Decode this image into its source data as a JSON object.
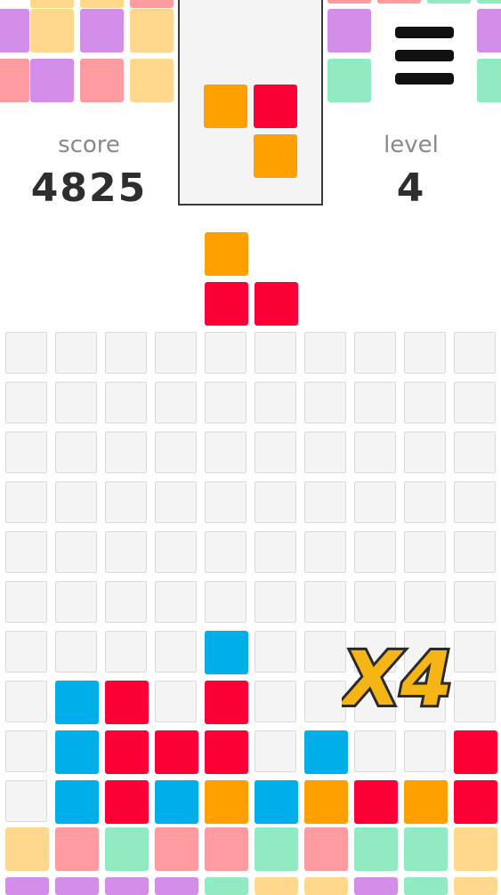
{
  "header": {
    "score_label": "score",
    "score_value": "4825",
    "level_label": "level",
    "level_value": "4"
  },
  "combo": {
    "text": "X4",
    "color": "#f5b514",
    "outline": "#2a2a2a"
  },
  "colors": {
    "orange": "#ffa000",
    "red": "#fb0034",
    "blue": "#00aeea",
    "cell": "#f4f4f4",
    "cell_border": "#d9d9d9",
    "pastel_pink": "#fd9ba0",
    "pastel_green": "#92eac3",
    "pastel_peach": "#ffd88d",
    "pastel_purple": "#d28ee9"
  },
  "next_piece": {
    "cells": [
      [
        0,
        0,
        "orange"
      ],
      [
        1,
        0,
        "red"
      ],
      [
        1,
        1,
        "orange"
      ]
    ]
  },
  "falling_piece": {
    "cells": [
      [
        4,
        0,
        "orange"
      ],
      [
        4,
        1,
        "red"
      ],
      [
        5,
        1,
        "red"
      ]
    ]
  },
  "board": {
    "cols": 10,
    "rows": 10,
    "filled": [
      [
        4,
        6,
        "blue"
      ],
      [
        1,
        7,
        "blue"
      ],
      [
        2,
        7,
        "red"
      ],
      [
        4,
        7,
        "red"
      ],
      [
        1,
        8,
        "blue"
      ],
      [
        2,
        8,
        "red"
      ],
      [
        3,
        8,
        "red"
      ],
      [
        4,
        8,
        "red"
      ],
      [
        6,
        8,
        "blue"
      ],
      [
        9,
        8,
        "red"
      ],
      [
        1,
        9,
        "blue"
      ],
      [
        2,
        9,
        "red"
      ],
      [
        3,
        9,
        "blue"
      ],
      [
        4,
        9,
        "orange"
      ],
      [
        5,
        9,
        "blue"
      ],
      [
        6,
        9,
        "orange"
      ],
      [
        7,
        9,
        "red"
      ],
      [
        8,
        9,
        "orange"
      ],
      [
        9,
        9,
        "red"
      ]
    ]
  },
  "decor": {
    "top_left": [
      [
        "pastel_peach",
        "pastel_peach",
        "pastel_pink"
      ],
      [
        "pastel_purple",
        "pastel_peach",
        "pastel_purple",
        "pastel_peach"
      ],
      [
        "pastel_pink",
        "pastel_purple",
        "pastel_pink",
        "pastel_peach"
      ]
    ],
    "top_right": [
      [
        "pastel_pink",
        "pastel_pink",
        "pastel_green",
        "pastel_green"
      ],
      [
        "pastel_purple",
        "pastel_purple"
      ],
      [
        "pastel_green",
        "pastel_green"
      ]
    ],
    "bottom_row": [
      "pastel_peach",
      "pastel_pink",
      "pastel_green",
      "pastel_pink",
      "pastel_pink",
      "pastel_green",
      "pastel_pink",
      "pastel_green",
      "pastel_green",
      "pastel_peach"
    ],
    "bottom_strip": [
      "pastel_purple",
      "pastel_purple",
      "pastel_purple",
      "pastel_purple",
      "pastel_green",
      "pastel_peach",
      "pastel_peach",
      "pastel_purple",
      "pastel_green",
      "pastel_peach"
    ]
  }
}
